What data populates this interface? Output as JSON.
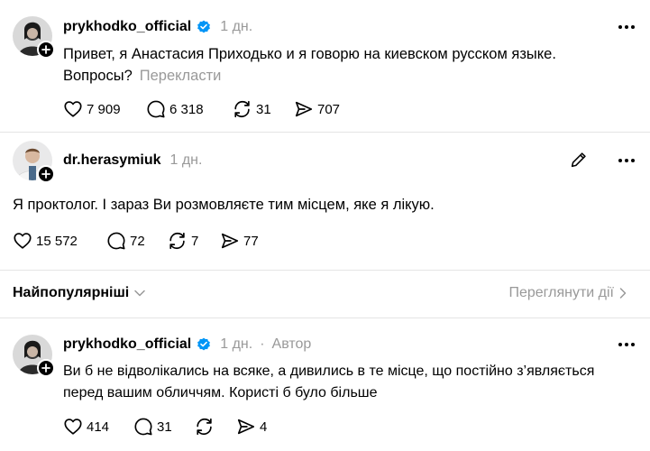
{
  "post1": {
    "username": "prykhodko_official",
    "time": "1 дн.",
    "text_line1": "Привет, я Анастасия Приходько и я говорю на киевском русском языке.",
    "text_line2": "Вопросы?",
    "translate_label": "Перекласти",
    "likes": "7 909",
    "comments": "6 318",
    "reposts": "31",
    "shares": "707"
  },
  "post2": {
    "username": "dr.herasymiuk",
    "time": "1 дн.",
    "text": "Я проктолог. І зараз Ви розмовляєте тим місцем, яке я лікую.",
    "likes": "15 572",
    "comments": "72",
    "reposts": "7",
    "shares": "77"
  },
  "sort_bar": {
    "label": "Найпопулярніші",
    "view_activity": "Переглянути дії"
  },
  "reply": {
    "username": "prykhodko_official",
    "time": "1 дн.",
    "separator": "·",
    "author_tag": "Автор",
    "text_line1": "Ви б не відволікались на всяке, а дивились в те місце, що постійно з’являється",
    "text_line2": "перед вашим обличчям. Користі б було більше",
    "likes": "414",
    "comments": "31",
    "shares": "4"
  },
  "colors": {
    "verified": "#0095f6",
    "muted": "#999999",
    "divider": "#e5e5e5"
  }
}
